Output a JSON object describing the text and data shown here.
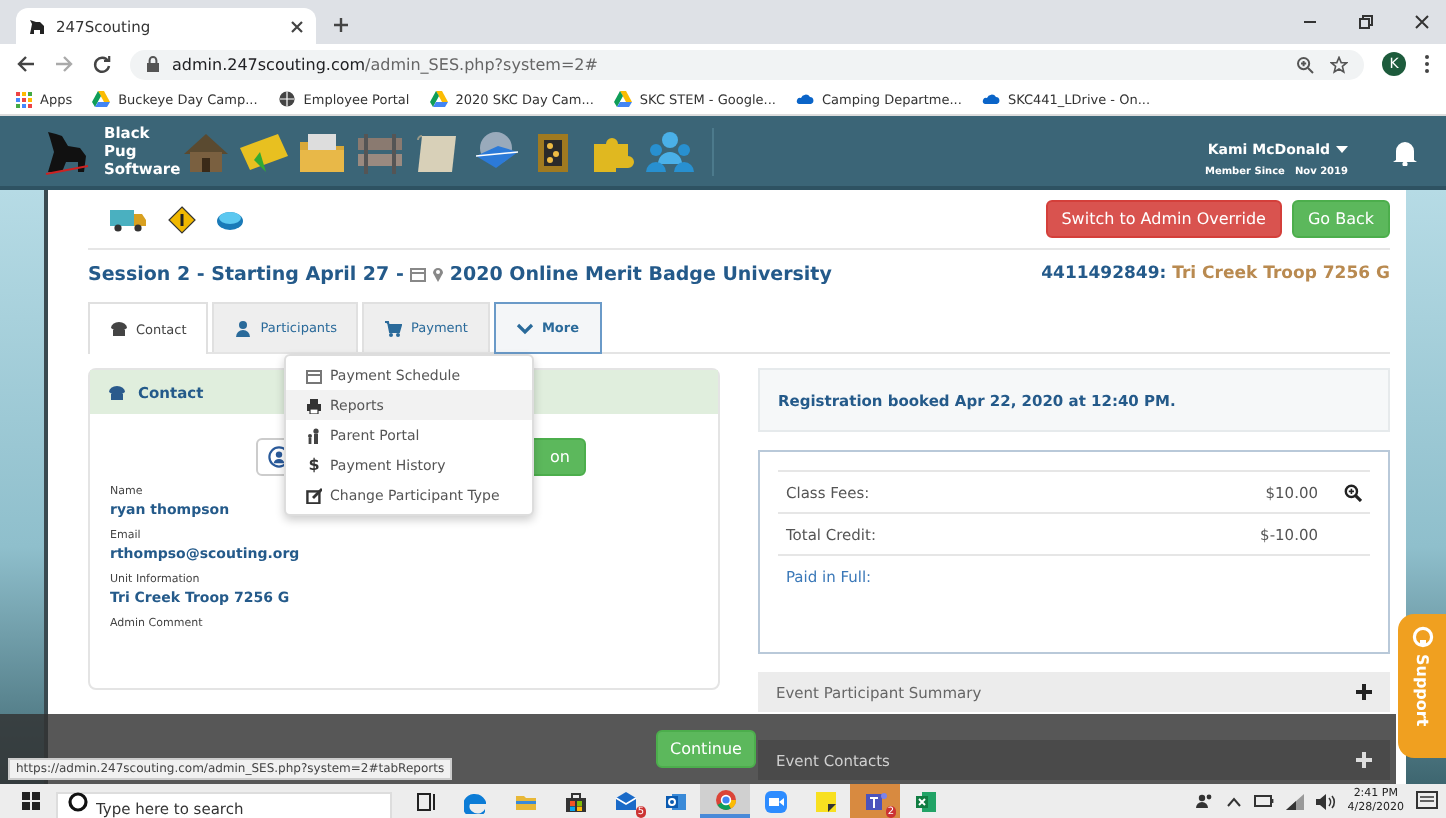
{
  "browser": {
    "tab_title": "247Scouting",
    "url_host": "admin.247scouting.com",
    "url_path": "/admin_SES.php?system=2#",
    "avatar_letter": "K",
    "apps_label": "Apps",
    "bookmarks": [
      {
        "label": "Buckeye Day Camp...",
        "kind": "drive"
      },
      {
        "label": "Employee Portal",
        "kind": "globe"
      },
      {
        "label": "2020 SKC Day Cam...",
        "kind": "drive"
      },
      {
        "label": "SKC STEM - Google...",
        "kind": "drive"
      },
      {
        "label": "Camping Departme...",
        "kind": "cloud"
      },
      {
        "label": "SKC441_LDrive - On...",
        "kind": "cloud"
      }
    ]
  },
  "app_header": {
    "brand": "Black Pug Software",
    "user_name": "Kami McDonald",
    "member_since_label": "Member Since",
    "member_since": "Nov 2019"
  },
  "actions": [
    {
      "label": "Switch to Admin Override",
      "kind": "danger"
    },
    {
      "label": "Go Back",
      "kind": "success"
    }
  ],
  "session": {
    "title": "Session 2 - Starting April 27 -",
    "event": "2020 Online Merit Badge University",
    "account_id": "4411492849:",
    "unit": "Tri Creek Troop 7256 G"
  },
  "tabs": [
    {
      "label": "Contact",
      "selected": true,
      "expanded": false
    },
    {
      "label": "Participants",
      "selected": false,
      "expanded": false
    },
    {
      "label": "Payment",
      "selected": false,
      "expanded": false
    },
    {
      "label": "More",
      "selected": false,
      "expanded": true
    }
  ],
  "more_menu": [
    {
      "label": "Payment Schedule",
      "highlighted": false
    },
    {
      "label": "Reports",
      "highlighted": true
    },
    {
      "label": "Parent Portal",
      "highlighted": false
    },
    {
      "label": "Payment History",
      "glyph": "$",
      "highlighted": false
    },
    {
      "label": "Change Participant Type",
      "highlighted": false
    }
  ],
  "contact": {
    "heading": "Contact",
    "button_label": "on",
    "fields": [
      {
        "label": "Name",
        "value": "ryan thompson"
      },
      {
        "label": "Email",
        "value": "rthompso@scouting.org"
      },
      {
        "label": "Unit Information",
        "value": "Tri Creek Troop 7256 G"
      },
      {
        "label": "Admin Comment"
      }
    ]
  },
  "registration": "Registration booked Apr 22, 2020 at 12:40 PM.",
  "fees": [
    {
      "label": "Class Fees:",
      "value": "$10.00",
      "kind": "detail"
    },
    {
      "label": "Total Credit:",
      "value": "$-10.00",
      "kind": "plain"
    },
    {
      "label": "Paid in Full:",
      "kind": "status"
    }
  ],
  "sections": [
    {
      "title": "Event Participant Summary",
      "expanded": false
    },
    {
      "title": "Event Contacts",
      "expanded": false
    }
  ],
  "continue_label": "Continue",
  "status_url": "https://admin.247scouting.com/admin_SES.php?system=2#tabReports",
  "support_label": "Support",
  "taskbar": {
    "search_placeholder": "Type here to search",
    "time": "2:41 PM",
    "date": "4/28/2020",
    "apps": [
      {
        "kind": "taskview",
        "active": false,
        "flashing": false
      },
      {
        "kind": "edge",
        "active": false,
        "flashing": false
      },
      {
        "kind": "explorer",
        "active": false,
        "flashing": false
      },
      {
        "kind": "store",
        "active": false,
        "flashing": false
      },
      {
        "kind": "mail",
        "badge": "5",
        "active": false,
        "flashing": false
      },
      {
        "kind": "outlook",
        "active": false,
        "flashing": false
      },
      {
        "kind": "chrome",
        "active": true,
        "flashing": false
      },
      {
        "kind": "zoom",
        "active": false,
        "flashing": false
      },
      {
        "kind": "notes",
        "active": false,
        "flashing": false
      },
      {
        "kind": "teams",
        "badge": "2",
        "active": false,
        "flashing": true
      },
      {
        "kind": "excel",
        "active": false,
        "flashing": false
      }
    ]
  }
}
